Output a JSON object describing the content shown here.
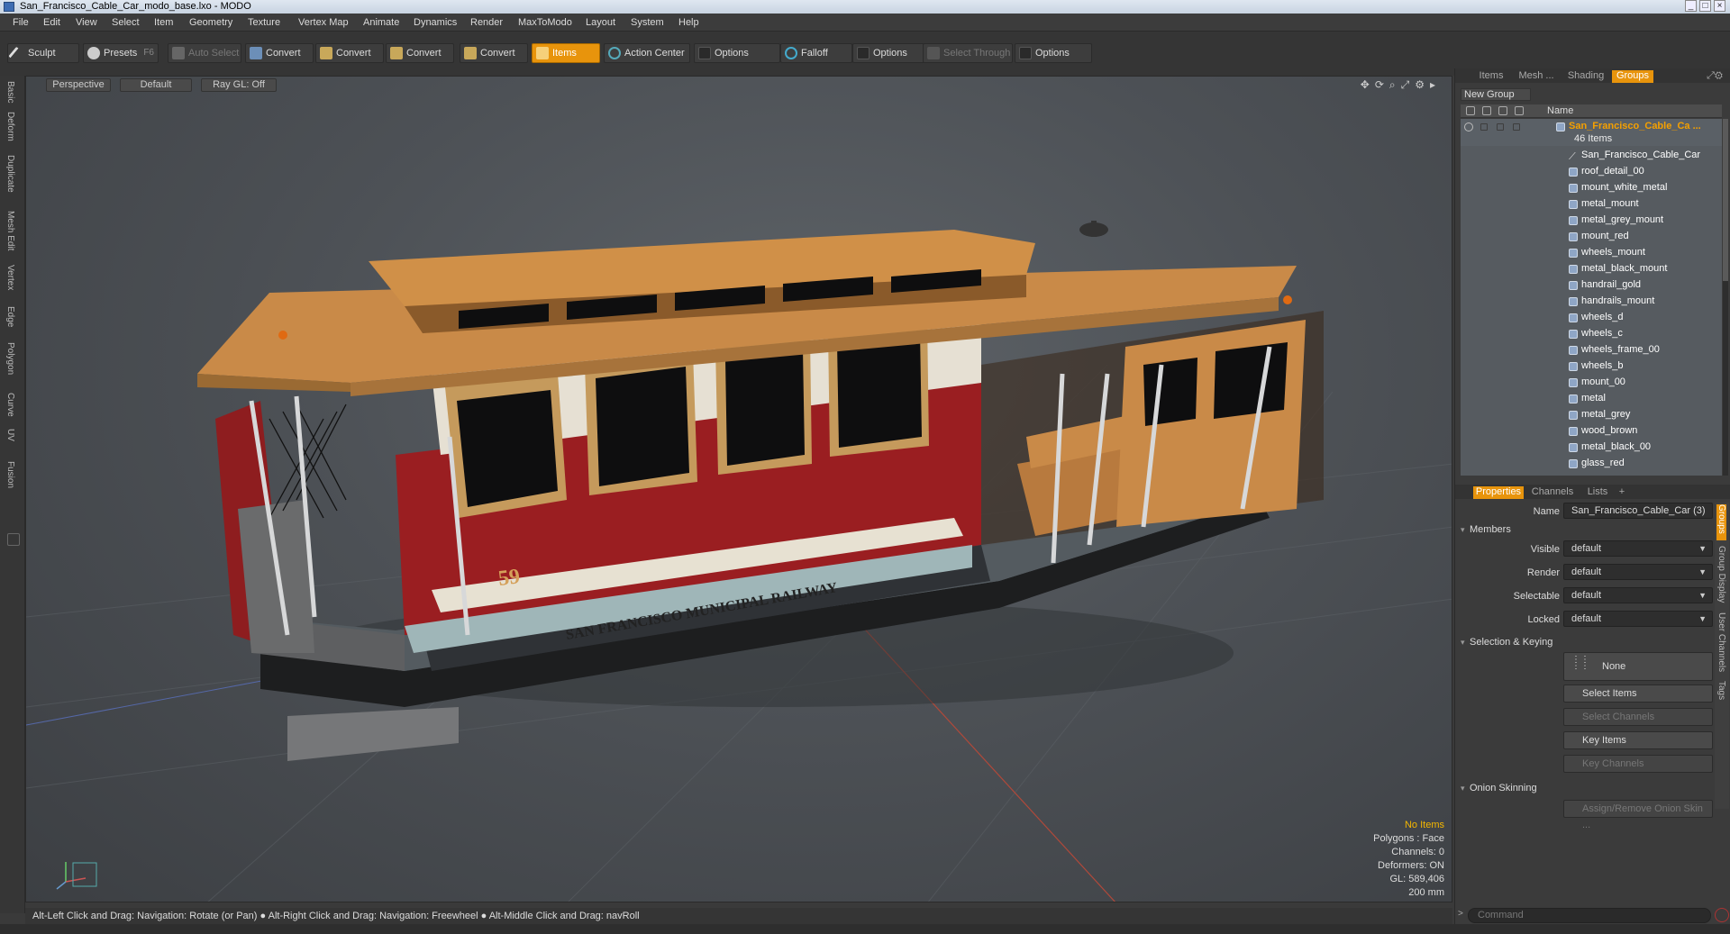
{
  "window": {
    "title": "San_Francisco_Cable_Car_modo_base.lxo - MODO"
  },
  "menu": [
    "File",
    "Edit",
    "View",
    "Select",
    "Item",
    "Geometry",
    "Texture",
    "Vertex Map",
    "Animate",
    "Dynamics",
    "Render",
    "MaxToModo",
    "Layout",
    "System",
    "Help"
  ],
  "toolbar": {
    "sculpt": "Sculpt",
    "presets": "Presets",
    "presets_key": "F6",
    "auto_select": "Auto Select",
    "convert1": "Convert",
    "convert2": "Convert",
    "convert3": "Convert",
    "convert4": "Convert",
    "items": "Items",
    "action_center": "Action Center",
    "options1": "Options",
    "falloff": "Falloff",
    "options2": "Options",
    "select_through": "Select Through",
    "options3": "Options"
  },
  "left_tabs": [
    "Basic",
    "Deform",
    "Duplicate",
    "Mesh Edit",
    "Vertex",
    "Edge",
    "Polygon",
    "Curve",
    "UV",
    "Fusion"
  ],
  "viewport": {
    "view": "Perspective",
    "shading": "Default",
    "raygl": "Ray GL: Off",
    "stats": {
      "selection": "No Items",
      "polygons": "Polygons : Face",
      "channels": "Channels: 0",
      "deformers": "Deformers: ON",
      "gl": "GL: 589,406",
      "scale": "200 mm"
    },
    "car_number": "59",
    "car_lettering": "SAN FRANCISCO MUNICIPAL RAILWAY"
  },
  "status": {
    "hint1": "Alt-Left Click and Drag: Navigation: Rotate (or Pan)",
    "hint2": "Alt-Right Click and Drag: Navigation: Freewheel",
    "hint3": "Alt-Middle Click and Drag: navRoll"
  },
  "groups_panel": {
    "tabs": [
      "Items",
      "Mesh ...",
      "Shading",
      "Groups"
    ],
    "active_tab": "Groups",
    "new_group": "New Group",
    "column_name": "Name",
    "group": {
      "name": "San_Francisco_Cable_Ca ...",
      "count": "46 Items"
    },
    "items": [
      "San_Francisco_Cable_Car",
      "roof_detail_00",
      "mount_white_metal",
      "metal_mount",
      "metal_grey_mount",
      "mount_red",
      "wheels_mount",
      "metal_black_mount",
      "handrail_gold",
      "handrails_mount",
      "wheels_d",
      "wheels_c",
      "wheels_frame_00",
      "wheels_b",
      "mount_00",
      "metal",
      "metal_grey",
      "wood_brown",
      "metal_black_00",
      "glass_red"
    ]
  },
  "properties_panel": {
    "tabs": [
      "Properties",
      "Channels",
      "Lists"
    ],
    "active_tab": "Properties",
    "name_label": "Name",
    "name_value": "San_Francisco_Cable_Car (3)",
    "members_section": "Members",
    "visible_label": "Visible",
    "visible_value": "default",
    "render_label": "Render",
    "render_value": "default",
    "selectable_label": "Selectable",
    "selectable_value": "default",
    "locked_label": "Locked",
    "locked_value": "default",
    "selection_section": "Selection & Keying",
    "none_btn": "None",
    "select_items": "Select Items",
    "select_channels": "Select Channels",
    "key_items": "Key Items",
    "key_channels": "Key Channels",
    "onion_section": "Onion Skinning",
    "onion_btn": "Assign/Remove Onion Skin ...",
    "side_tabs": [
      "Groups",
      "Group Display",
      "User Channels",
      "Tags"
    ]
  },
  "command": {
    "placeholder": "Command"
  },
  "colors": {
    "accent": "#e8940c",
    "roof": "#d18f45",
    "red_body": "#8e1d1f",
    "viewport_bg": "#4d5156"
  }
}
